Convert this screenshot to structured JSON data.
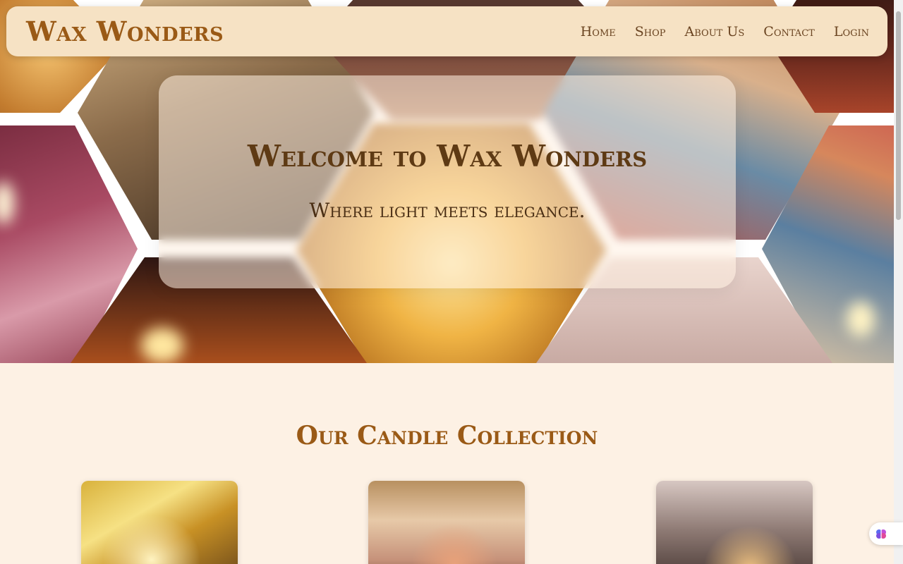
{
  "navbar": {
    "brand": "Wax Wonders",
    "links": [
      "Home",
      "Shop",
      "About Us",
      "Contact",
      "Login"
    ]
  },
  "hero": {
    "title": "Welcome to Wax Wonders",
    "subtitle": "Where light meets elegance."
  },
  "collection": {
    "title": "Our Candle Collection"
  },
  "colors": {
    "brand": "#9a5a16",
    "nav_bg": "#f6e2c4",
    "page_bg": "#fdf1e4",
    "text_dark": "#5e3a14"
  },
  "icons": {
    "assistant": "brain-icon"
  }
}
